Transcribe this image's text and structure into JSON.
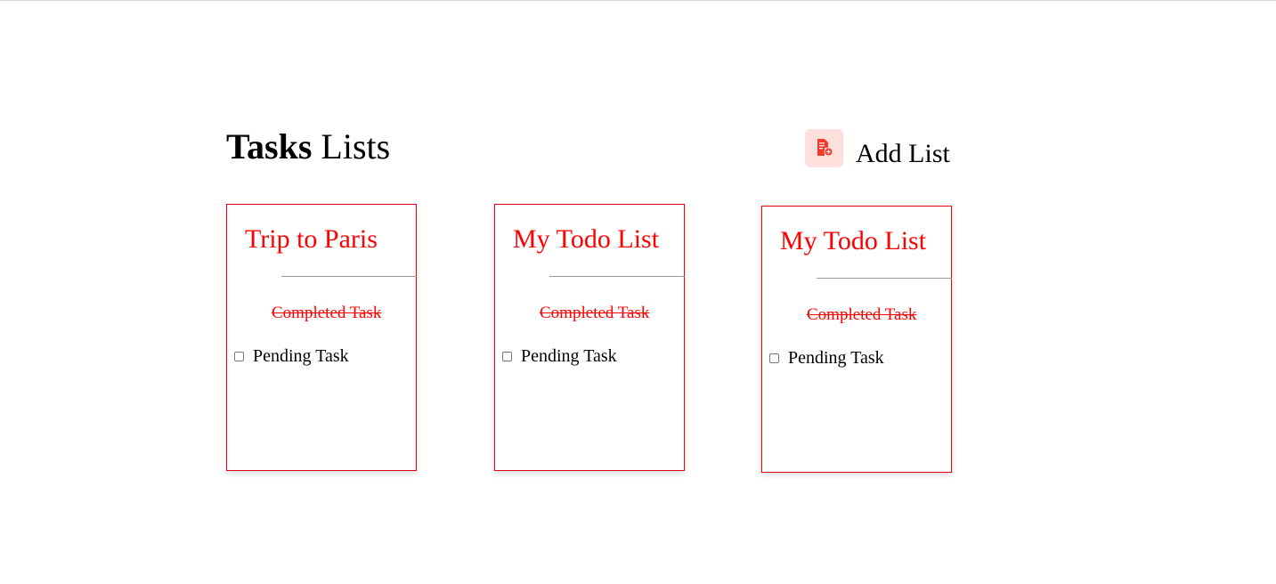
{
  "header": {
    "title_bold": "Tasks",
    "title_rest": " Lists",
    "add_list_label": "Add List",
    "add_list_icon": "add-document-icon"
  },
  "colors": {
    "accent": "#ff0000",
    "icon_bg": "#fde0dc"
  },
  "lists": [
    {
      "title": "Trip to Paris",
      "completed_task": "Completed Task",
      "pending_task": "Pending Task"
    },
    {
      "title": "My Todo List",
      "completed_task": "Completed Task",
      "pending_task": "Pending Task"
    },
    {
      "title": "My Todo List",
      "completed_task": "Completed Task",
      "pending_task": "Pending Task"
    }
  ]
}
